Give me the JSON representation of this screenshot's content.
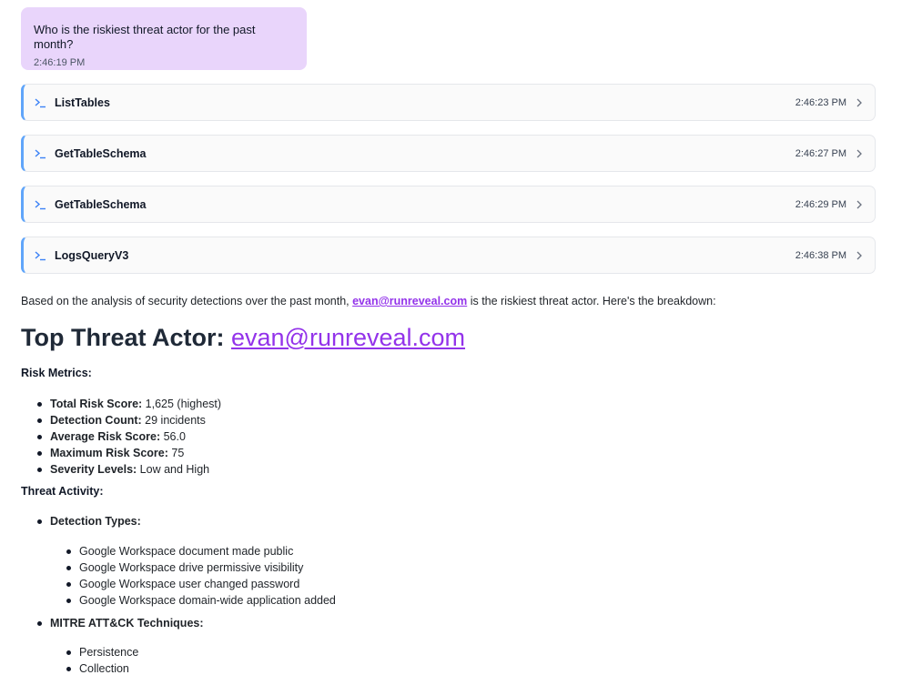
{
  "user_message": {
    "text": "Who is the riskiest threat actor for the past month?",
    "time": "2:46:19 PM"
  },
  "tool_calls": [
    {
      "name": "ListTables",
      "time": "2:46:23 PM"
    },
    {
      "name": "GetTableSchema",
      "time": "2:46:27 PM"
    },
    {
      "name": "GetTableSchema",
      "time": "2:46:29 PM"
    },
    {
      "name": "LogsQueryV3",
      "time": "2:46:38 PM"
    }
  ],
  "response": {
    "intro_before": "Based on the analysis of security detections over the past month, ",
    "actor_email": "evan@runreveal.com",
    "intro_after": " is the riskiest threat actor. Here's the breakdown:",
    "heading_prefix": "Top Threat Actor: ",
    "risk_metrics_label": "Risk Metrics:",
    "risk_metrics": [
      {
        "key": "Total Risk Score:",
        "value": " 1,625 (highest)"
      },
      {
        "key": "Detection Count:",
        "value": " 29 incidents"
      },
      {
        "key": "Average Risk Score:",
        "value": " 56.0"
      },
      {
        "key": "Maximum Risk Score:",
        "value": " 75"
      },
      {
        "key": "Severity Levels:",
        "value": " Low and High"
      }
    ],
    "threat_activity_label": "Threat Activity:",
    "detection_types_label": "Detection Types:",
    "detection_types": [
      "Google Workspace document made public",
      "Google Workspace drive permissive visibility",
      "Google Workspace user changed password",
      "Google Workspace domain-wide application added"
    ],
    "mitre_label": "MITRE ATT&CK Techniques:",
    "mitre_techniques": [
      "Persistence",
      "Collection"
    ]
  },
  "colors": {
    "user_bubble": "#e9d5fb",
    "tool_accent": "#60a5fa",
    "link": "#9333ea"
  },
  "icons": {
    "tool": "terminal-icon",
    "expand": "chevron-right-icon"
  }
}
